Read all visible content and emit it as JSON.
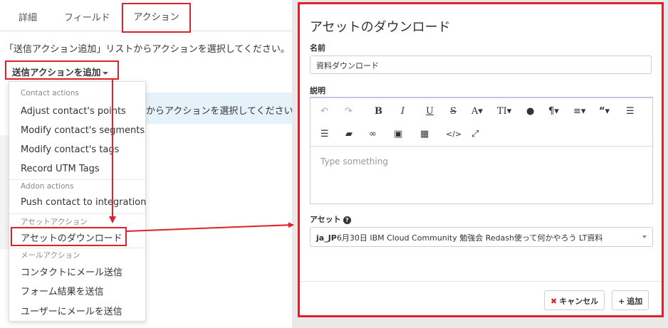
{
  "tabs": [
    {
      "label": "詳細"
    },
    {
      "label": "フィールド"
    },
    {
      "label": "アクション",
      "active": true
    }
  ],
  "instruction": "「送信アクション追加」リストからアクションを選択してください。",
  "add_button": "送信アクションを追加",
  "background_message": "からアクションを選択してください。",
  "menu": {
    "groups": [
      {
        "header": "Contact actions",
        "items": [
          "Adjust contact's points",
          "Modify contact's segments",
          "Modify contact's tags",
          "Record UTM Tags"
        ]
      },
      {
        "header": "Addon actions",
        "items": [
          "Push contact to integration"
        ]
      },
      {
        "header": "アセットアクション",
        "items": [
          "アセットのダウンロード"
        ]
      },
      {
        "header": "メールアクション",
        "items": [
          "コンタクトにメール送信",
          "フォーム結果を送信",
          "ユーザーにメールを送信"
        ]
      }
    ]
  },
  "modal": {
    "title": "アセットのダウンロード",
    "name_label": "名前",
    "name_value": "資料ダウンロード",
    "description_label": "説明",
    "editor_placeholder": "Type something",
    "asset_label": "アセット",
    "asset_value_bold": "ja_JP",
    "asset_value": "6月30日 IBM Cloud Community 勉強会 Redash使って何かやろう LT資料",
    "cancel_label": "キャンセル",
    "add_label": "追加"
  },
  "toolbar_icons": [
    "undo-icon",
    "redo-icon",
    "bold-icon",
    "italic-icon",
    "underline-icon",
    "strikethrough-icon",
    "font-color-icon",
    "font-size-icon",
    "paint-drop-icon",
    "paragraph-icon",
    "align-icon",
    "quote-icon",
    "outdent-icon",
    "indent-icon",
    "eraser-icon",
    "link-icon",
    "image-icon",
    "table-icon",
    "code-icon",
    "fullscreen-icon"
  ],
  "colors": {
    "highlight": "#e0202a",
    "info_bg": "#e6f2fa"
  }
}
